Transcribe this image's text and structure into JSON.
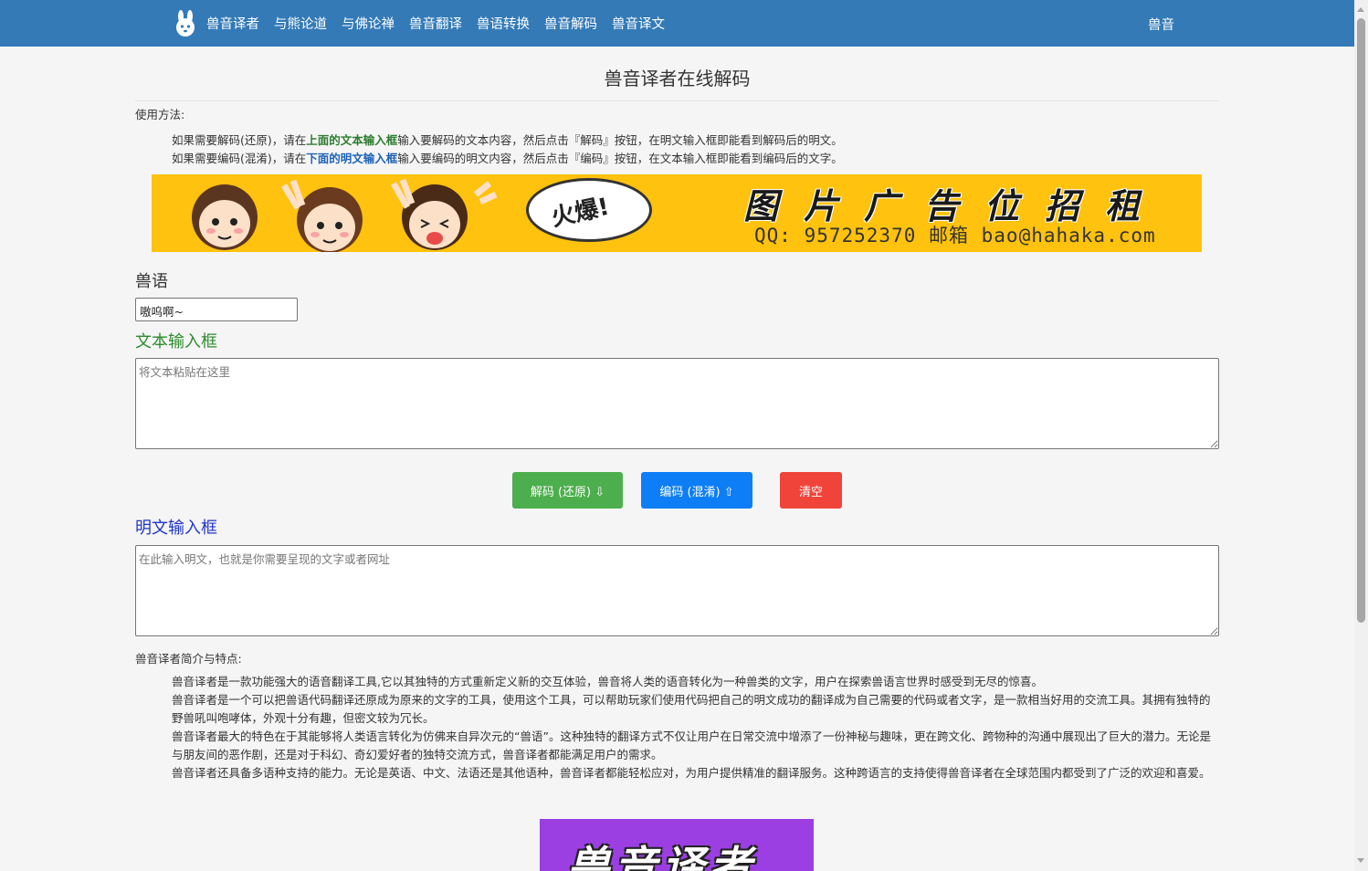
{
  "nav": {
    "brand": "兽音译者",
    "items": [
      "与熊论道",
      "与佛论禅",
      "兽音翻译",
      "兽语转换",
      "兽音解码",
      "兽音译文"
    ],
    "right": "兽音",
    "bg_color": "#337ab7",
    "logo_icon": "rabbit-icon"
  },
  "page": {
    "title": "兽音译者在线解码"
  },
  "usage": {
    "heading": "使用方法:",
    "line1": {
      "pre": "如果需要解码(还原)，请在",
      "highlight": "上面的文本输入框",
      "post": "输入要解码的文本内容，然后点击『解码』按钮，在明文输入框即能看到解码后的明文。"
    },
    "line2": {
      "pre": "如果需要编码(混淆)，请在",
      "highlight": "下面的明文输入框",
      "post": "输入要编码的明文内容，然后点击『编码』按钮，在文本输入框即能看到编码后的文字。"
    }
  },
  "banner": {
    "bubble": "火爆!",
    "big_text": "图片广告位招租",
    "small_text": "QQ: 957252370 邮箱 bao@hahaka.com",
    "bg_color": "#ffc20e"
  },
  "dialect": {
    "label": "兽语",
    "selected": "嗷呜啊~"
  },
  "text_box": {
    "label": "文本输入框",
    "placeholder": "将文本粘贴在这里",
    "label_color": "#2e8b2e"
  },
  "buttons": {
    "decode": "解码 (还原) ⇩",
    "encode": "编码 (混淆) ⇧",
    "clear": "清空",
    "decode_color": "#4cae4c",
    "encode_color": "#0d7ef5",
    "clear_color": "#f0443a"
  },
  "plain_box": {
    "label": "明文输入框",
    "placeholder": "在此输入明文，也就是你需要呈现的文字或者网址",
    "label_color": "#1f35c9"
  },
  "intro": {
    "heading": "兽音译者简介与特点:",
    "p1": "兽音译者是一款功能强大的语音翻译工具,它以其独特的方式重新定义新的交互体验，兽音将人类的语音转化为一种兽类的文字，用户在探索兽语言世界时感受到无尽的惊喜。",
    "p2": "兽音译者是一个可以把兽语代码翻译还原成为原来的文字的工具，使用这个工具，可以帮助玩家们使用代码把自己的明文成功的翻译成为自己需要的代码或者文字，是一款相当好用的交流工具。其拥有独特的野兽吼叫咆哮体，外观十分有趣，但密文较为冗长。",
    "p3": "兽音译者最大的特色在于其能够将人类语言转化为仿佛来自异次元的“兽语”。这种独特的翻译方式不仅让用户在日常交流中增添了一份神秘与趣味，更在跨文化、跨物种的沟通中展现出了巨大的潜力。无论是与朋友间的恶作剧，还是对于科幻、奇幻爱好者的独特交流方式，兽音译者都能满足用户的需求。",
    "p4": "兽音译者还具备多语种支持的能力。无论是英语、中文、法语还是其他语种，兽音译者都能轻松应对，为用户提供精准的翻译服务。这种跨语言的支持使得兽音译者在全球范围内都受到了广泛的欢迎和喜爱。"
  },
  "bottom_image": {
    "text": "兽音译者",
    "bg_color": "#9b3fe3"
  }
}
